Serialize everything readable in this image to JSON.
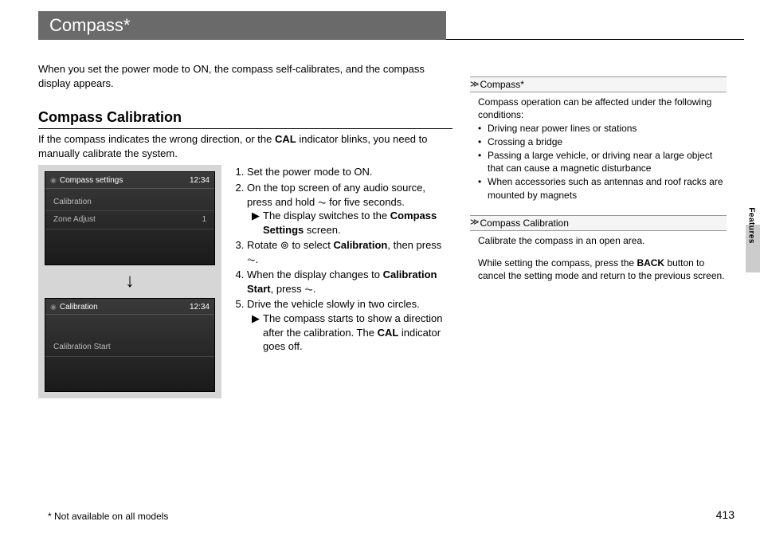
{
  "title": "Compass*",
  "intro": "When you set the power mode to ON, the compass self-calibrates, and the compass display appears.",
  "section_heading": "Compass Calibration",
  "section_intro_pre": "If the compass indicates the wrong direction, or the ",
  "section_intro_bold": "CAL",
  "section_intro_post": " indicator blinks, you need to manually calibrate the system.",
  "screen1": {
    "title": "Compass settings",
    "clock": "12:34",
    "row1": "Calibration",
    "row2_label": "Zone Adjust",
    "row2_value": "1"
  },
  "screen2": {
    "title": "Calibration",
    "clock": "12:34",
    "row": "Calibration Start"
  },
  "steps": {
    "s1": "Set the power mode to ON.",
    "s2": "On the top screen of any audio source, press and hold ",
    "s2_icon": "⏦",
    "s2_tail": " for five seconds.",
    "s2_sub_pre": "The display switches to the ",
    "s2_sub_bold": "Compass Settings",
    "s2_sub_post": " screen.",
    "s3_pre": "Rotate ",
    "s3_icon": "⊚",
    "s3_mid": " to select ",
    "s3_bold": "Calibration",
    "s3_post": ", then press ",
    "s3_icon2": "⏦",
    "s3_tail": ".",
    "s4_pre": "When the display changes to ",
    "s4_bold": "Calibration Start",
    "s4_post": ", press ",
    "s4_icon": "⏦",
    "s4_tail": ".",
    "s5": "Drive the vehicle slowly in two circles.",
    "s5_sub_pre": "The compass starts to show a direction after the calibration. The ",
    "s5_sub_bold": "CAL",
    "s5_sub_post": " indicator goes off."
  },
  "side1": {
    "title": "Compass*",
    "lead": "Compass operation can be affected under the following conditions:",
    "items": [
      "Driving near power lines or stations",
      "Crossing a bridge",
      "Passing a large vehicle, or driving near a large object that can cause a magnetic disturbance",
      "When accessories such as antennas and roof racks are mounted by magnets"
    ]
  },
  "side2": {
    "title": "Compass Calibration",
    "p1": "Calibrate the compass in an open area.",
    "p2_pre": "While setting the compass, press the ",
    "p2_bold": "BACK",
    "p2_post": " button to cancel the setting mode and return to the previous screen."
  },
  "side_tab": "Features",
  "footnote": "* Not available on all models",
  "page_number": "413"
}
